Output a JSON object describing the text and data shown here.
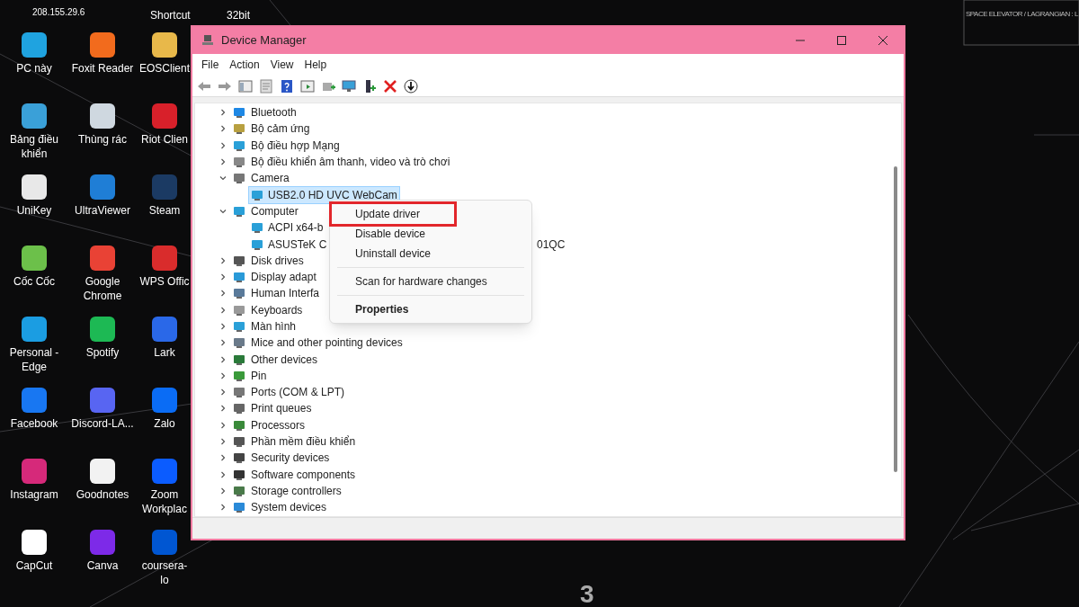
{
  "desktop": {
    "top_labels": [
      "208.155.29.6",
      "Shortcut",
      "32bit"
    ],
    "icons": [
      {
        "label": "PC này",
        "color": "#1fa3e0"
      },
      {
        "label": "Foxit Reader",
        "color": "#f26b1d"
      },
      {
        "label": "EOSClient",
        "color": "#e8b84a"
      },
      {
        "label": "Bảng điều khiển",
        "color": "#3aa0d8"
      },
      {
        "label": "Thùng rác",
        "color": "#cfd8e0"
      },
      {
        "label": "Riot Clien",
        "color": "#d8202a"
      },
      {
        "label": "UniKey",
        "color": "#e8e8e8"
      },
      {
        "label": "UltraViewer",
        "color": "#1f7ed6"
      },
      {
        "label": "Steam",
        "color": "#1b3a63"
      },
      {
        "label": "Cốc Cốc",
        "color": "#6cc04a"
      },
      {
        "label": "Google Chrome",
        "color": "#e94235"
      },
      {
        "label": "WPS Offic",
        "color": "#d92c2c"
      },
      {
        "label": "Personal - Edge",
        "color": "#1b9de2"
      },
      {
        "label": "Spotify",
        "color": "#1db954"
      },
      {
        "label": "Lark",
        "color": "#2a68e8"
      },
      {
        "label": "Facebook",
        "color": "#1877f2"
      },
      {
        "label": "Discord-LA...",
        "color": "#5865f2"
      },
      {
        "label": "Zalo",
        "color": "#0a6cf5"
      },
      {
        "label": "Instagram",
        "color": "#d6297a"
      },
      {
        "label": "Goodnotes",
        "color": "#f2f2f2"
      },
      {
        "label": "Zoom Workplac",
        "color": "#0b5cff"
      },
      {
        "label": "CapCut",
        "color": "#ffffff"
      },
      {
        "label": "Canva",
        "color": "#7d2ae8"
      },
      {
        "label": "coursera-lo",
        "color": "#0056d2"
      }
    ],
    "wallpaper_texts": [
      "SPACE ELEVATOR / LAGRANGIAN : L",
      "3"
    ]
  },
  "window": {
    "title": "Device Manager",
    "menu": [
      "File",
      "Action",
      "View",
      "Help"
    ],
    "tree": [
      {
        "label": "Bluetooth",
        "expanded": false
      },
      {
        "label": "Bộ cảm ứng",
        "expanded": false
      },
      {
        "label": "Bộ điều hợp Mạng",
        "expanded": false
      },
      {
        "label": "Bộ điều khiển âm thanh, video và trò chơi",
        "expanded": false
      },
      {
        "label": "Camera",
        "expanded": true,
        "children": [
          {
            "label": "USB2.0 HD UVC WebCam",
            "selected": true
          }
        ]
      },
      {
        "label": "Computer",
        "expanded": true,
        "children": [
          {
            "label": "ACPI x64-b",
            "selected": false
          },
          {
            "label": "ASUSTeK C",
            "label_past_menu": "01QC",
            "selected": false
          }
        ]
      },
      {
        "label": "Disk drives",
        "expanded": false
      },
      {
        "label": "Display adapt",
        "expanded": false
      },
      {
        "label": "Human Interfa",
        "expanded": false
      },
      {
        "label": "Keyboards",
        "expanded": false
      },
      {
        "label": "Màn hình",
        "expanded": false
      },
      {
        "label": "Mice and other pointing devices",
        "expanded": false
      },
      {
        "label": "Other devices",
        "expanded": false
      },
      {
        "label": "Pin",
        "expanded": false
      },
      {
        "label": "Ports (COM & LPT)",
        "expanded": false
      },
      {
        "label": "Print queues",
        "expanded": false
      },
      {
        "label": "Processors",
        "expanded": false
      },
      {
        "label": "Phần mềm điều khiển",
        "expanded": false
      },
      {
        "label": "Security devices",
        "expanded": false
      },
      {
        "label": "Software components",
        "expanded": false
      },
      {
        "label": "Storage controllers",
        "expanded": false
      },
      {
        "label": "System devices",
        "expanded": false
      }
    ]
  },
  "context_menu": [
    {
      "label": "Update driver",
      "separator_before": false,
      "highlighted": true,
      "default": false
    },
    {
      "label": "Disable device",
      "separator_before": false,
      "highlighted": false,
      "default": false
    },
    {
      "label": "Uninstall device",
      "separator_before": false,
      "highlighted": false,
      "default": false
    },
    {
      "label": "Scan for hardware changes",
      "separator_before": true,
      "highlighted": false,
      "default": false
    },
    {
      "label": "Properties",
      "separator_before": true,
      "highlighted": false,
      "default": true
    }
  ]
}
